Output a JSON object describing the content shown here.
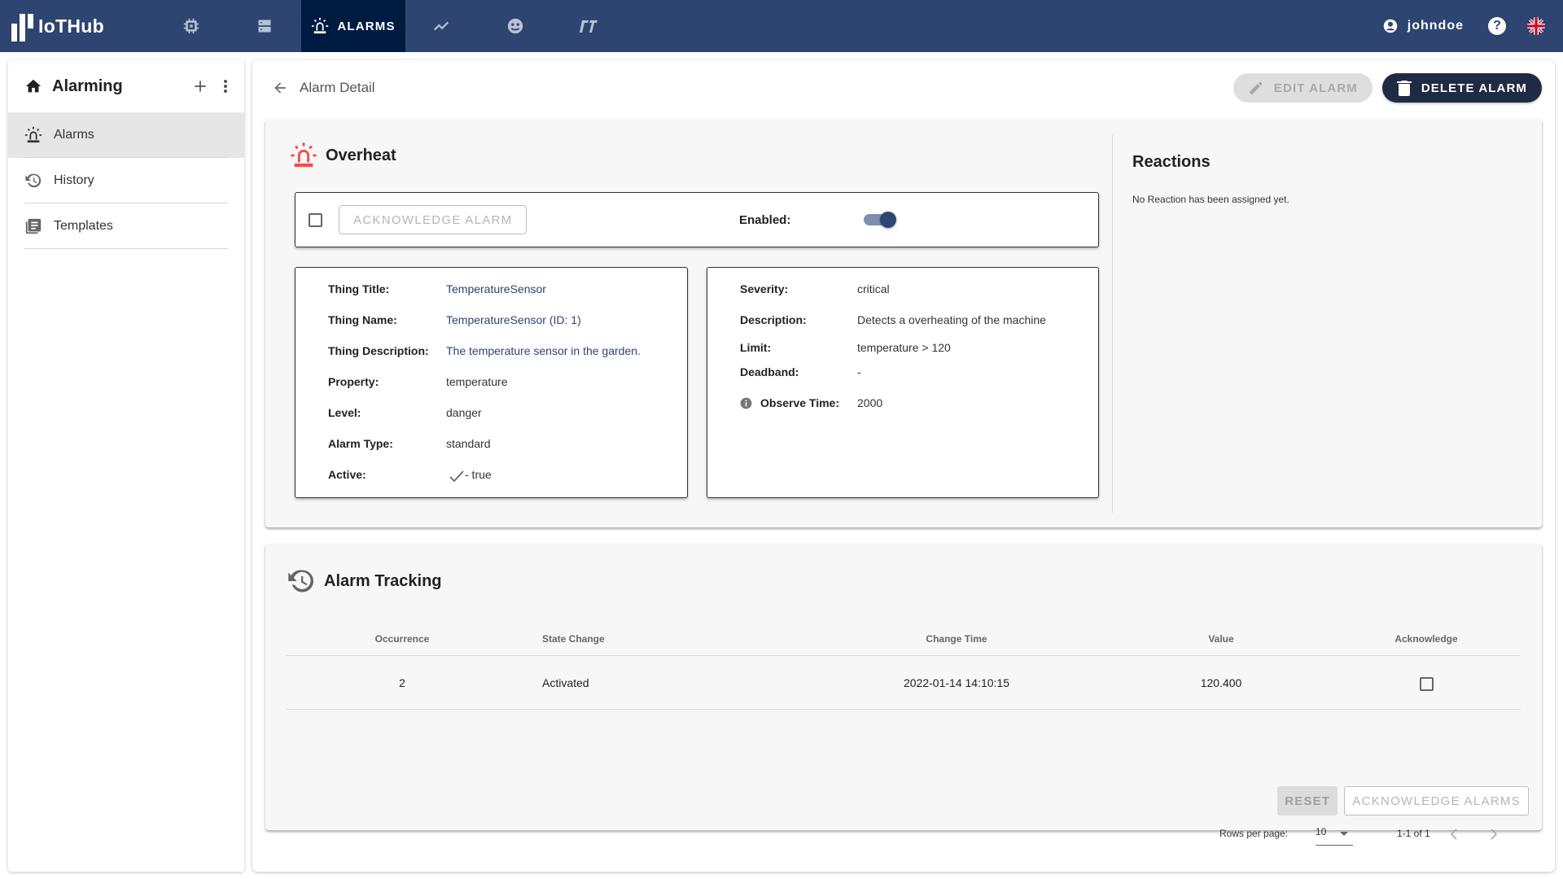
{
  "app": {
    "title": "IoTHub"
  },
  "nav": {
    "items": [
      {
        "icon": "chip-icon",
        "label": ""
      },
      {
        "icon": "server-icon",
        "label": ""
      },
      {
        "icon": "alarm-light-icon",
        "label": "ALARMS",
        "active": true
      },
      {
        "icon": "chart-line-icon",
        "label": ""
      },
      {
        "icon": "face-icon",
        "label": ""
      },
      {
        "icon": "logo-icon",
        "label": ""
      }
    ]
  },
  "user": {
    "name": "johndoe",
    "help_glyph": "?",
    "language": "en"
  },
  "sidebar": {
    "title": "Alarming",
    "items": [
      {
        "label": "Alarms",
        "icon": "alarm-light-icon",
        "active": true
      },
      {
        "label": "History",
        "icon": "history-icon"
      },
      {
        "label": "Templates",
        "icon": "templates-icon"
      }
    ]
  },
  "page": {
    "title": "Alarm Detail",
    "edit_label": "EDIT ALARM",
    "delete_label": "DELETE ALARM"
  },
  "alarm": {
    "name": "Overheat",
    "acknowledge_label": "ACKNOWLEDGE ALARM",
    "acknowledged": false,
    "enabled_label": "Enabled:",
    "enabled": true,
    "left": [
      {
        "key": "Thing Title:",
        "value": "TemperatureSensor",
        "link": true
      },
      {
        "key": "Thing Name:",
        "value": "TemperatureSensor (ID: 1)",
        "link": true
      },
      {
        "key": "Thing Description:",
        "value": "The temperature sensor in the garden.",
        "link": true
      },
      {
        "key": "Property:",
        "value": "temperature"
      },
      {
        "key": "Level:",
        "value": "danger"
      },
      {
        "key": "Alarm Type:",
        "value": "standard"
      },
      {
        "key": "Active:",
        "value": "- true",
        "check": true
      }
    ],
    "right": [
      {
        "key": "Severity:",
        "value": "critical"
      },
      {
        "key": "Description:",
        "value": "Detects a overheating of the machine"
      },
      {
        "key": "Limit:",
        "value": "temperature > 120"
      },
      {
        "key": "Deadband:",
        "value": "-"
      },
      {
        "key": "Observe Time:",
        "value": "2000",
        "info": true
      }
    ]
  },
  "reactions": {
    "title": "Reactions",
    "empty": "No Reaction has been assigned yet."
  },
  "tracking": {
    "title": "Alarm Tracking",
    "columns": [
      "Occurrence",
      "State Change",
      "Change Time",
      "Value",
      "Acknowledge"
    ],
    "rows": [
      {
        "occurrence": "2",
        "state": "Activated",
        "time": "2022-01-14 14:10:15",
        "value": "120.400",
        "acknowledged": false
      }
    ],
    "rows_per_page_label": "Rows per page:",
    "rows_per_page": "10",
    "range": "1-1 of 1",
    "reset_label": "RESET",
    "ack_all_label": "ACKNOWLEDGE ALARMS"
  }
}
